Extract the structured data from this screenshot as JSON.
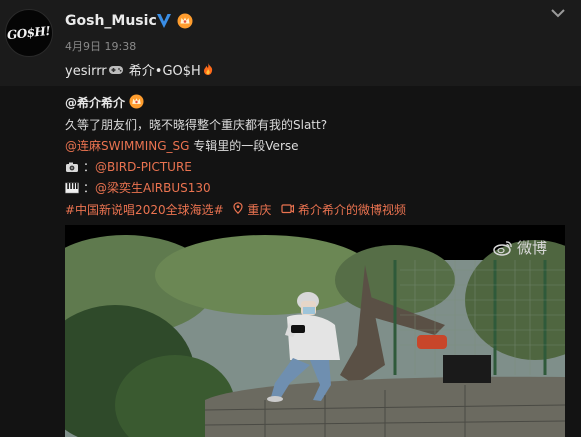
{
  "post": {
    "author": "Gosh_Music",
    "avatar_text": "GO$H!",
    "timestamp": "4月9日 19:38",
    "text_a": "yesirrr",
    "text_b": "希介•GO$H"
  },
  "repost": {
    "author": "@希介希介",
    "line1": "久等了朋友们，晓不晓得整个重庆都有我的Slatt?",
    "line2_link": "@连麻SWIMMING_SG",
    "line2_text": " 专辑里的一段Verse",
    "line3_prefix": "：",
    "line3_link": "@BIRD-PICTURE",
    "line4_prefix": "：",
    "line4_link": "@梁奕生AIRBUS130",
    "topic": "#中国新说唱2020全球海选#",
    "location": "重庆",
    "video_source": "希介希介的微博视频"
  },
  "video": {
    "watermark": "微博"
  },
  "icons": {
    "verified": "verified-v-icon",
    "vip": "vip-crown-icon",
    "chevron": "chevron-down-icon",
    "camera": "camera-icon",
    "piano": "piano-icon",
    "location": "location-pin-icon",
    "video_link": "video-link-icon",
    "game": "gamepad-icon",
    "fire": "fire-icon"
  },
  "colors": {
    "link": "#eb7350",
    "verified": "#3a8ee6",
    "background": "#1b1b1b",
    "repost_background": "#131313"
  }
}
